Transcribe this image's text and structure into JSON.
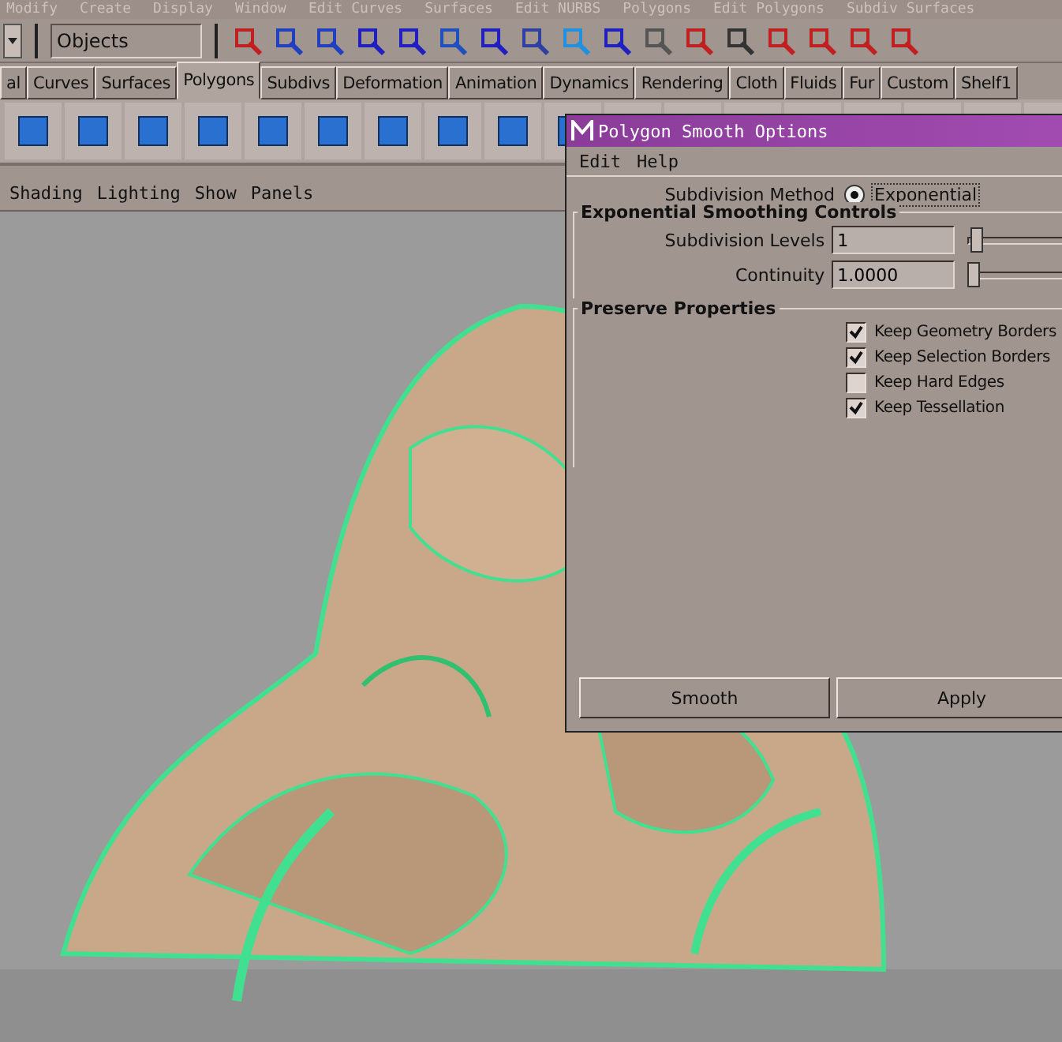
{
  "main_menu": [
    "Modify",
    "Create",
    "Display",
    "Window",
    "Edit Curves",
    "Surfaces",
    "Edit NURBS",
    "Polygons",
    "Edit Polygons",
    "Subdiv Surfaces"
  ],
  "status_line": {
    "selection_mode": "Objects"
  },
  "shelf_tabs": [
    {
      "label": "al",
      "selected": false
    },
    {
      "label": "Curves",
      "selected": false
    },
    {
      "label": "Surfaces",
      "selected": false
    },
    {
      "label": "Polygons",
      "selected": true
    },
    {
      "label": "Subdivs",
      "selected": false
    },
    {
      "label": "Deformation",
      "selected": false
    },
    {
      "label": "Animation",
      "selected": false
    },
    {
      "label": "Dynamics",
      "selected": false
    },
    {
      "label": "Rendering",
      "selected": false
    },
    {
      "label": "Cloth",
      "selected": false
    },
    {
      "label": "Fluids",
      "selected": false
    },
    {
      "label": "Fur",
      "selected": false
    },
    {
      "label": "Custom",
      "selected": false
    },
    {
      "label": "Shelf1",
      "selected": false
    }
  ],
  "viewport": {
    "menu": [
      "Shading",
      "Lighting",
      "Show",
      "Panels"
    ],
    "kind": "picture"
  },
  "dialog": {
    "title": "Polygon Smooth Options",
    "menu": [
      "Edit",
      "Help"
    ],
    "method": {
      "label": "Subdivision Method",
      "option": "Exponential",
      "selected": true
    },
    "smoothing_group": {
      "title": "Exponential Smoothing Controls",
      "fields": [
        {
          "label": "Subdivision Levels",
          "value": "1",
          "level": 0.03
        },
        {
          "label": "Continuity",
          "value": "1.0000",
          "level": 0.0
        }
      ]
    },
    "preserve_group": {
      "title": "Preserve Properties",
      "options": [
        {
          "label": "Keep Geometry Borders",
          "checked": true
        },
        {
          "label": "Keep Selection Borders",
          "checked": true
        },
        {
          "label": "Keep Hard Edges",
          "checked": false
        },
        {
          "label": "Keep Tessellation",
          "checked": true
        }
      ]
    },
    "buttons": [
      "Smooth",
      "Apply"
    ]
  }
}
